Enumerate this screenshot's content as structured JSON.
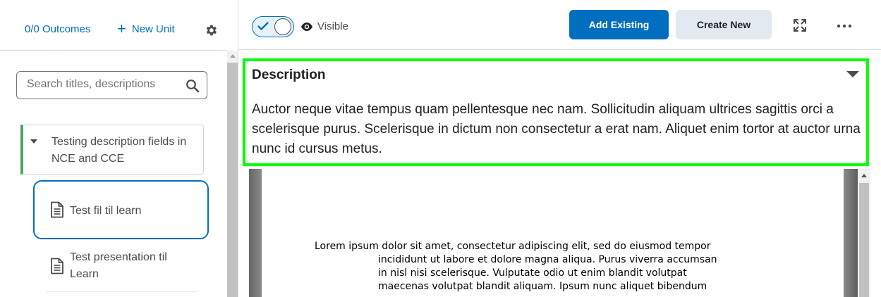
{
  "left_panel": {
    "outcomes_link": "0/0 Outcomes",
    "new_unit_label": "New Unit",
    "search": {
      "placeholder": "Search titles, descriptions",
      "value": ""
    },
    "unit": {
      "title": "Testing description fields in NCE and CCE",
      "expanded": true,
      "accent_color": "#46a661"
    },
    "lessons": [
      {
        "label": "Test fil til learn",
        "icon": "document-icon",
        "selected": true
      },
      {
        "label": "Test presentation til Learn",
        "icon": "document-icon",
        "selected": false
      }
    ]
  },
  "toolbar": {
    "visibility_toggle_on": true,
    "visibility_label": "Visible",
    "add_existing_label": "Add Existing",
    "create_new_label": "Create New",
    "icons": [
      "fullscreen-icon",
      "more-options-icon",
      "settings-gear-icon",
      "eye-icon"
    ]
  },
  "description": {
    "title": "Description",
    "body": "Auctor neque vitae tempus quam pellentesque nec nam. Sollicitudin aliquam ultrices sagittis orci a scelerisque purus. Scelerisque in dictum non consectetur a erat nam. Aliquet enim tortor at auctor urna nunc id cursus metus.",
    "highlight_color": "#00ff00"
  },
  "document_preview": {
    "first_line": "Lorem ipsum dolor sit amet, consectetur adipiscing elit, sed do eiusmod tempor",
    "continuation_lines": [
      "incididunt ut labore et dolore magna aliqua. Purus viverra accumsan",
      "in nisl nisi scelerisque. Vulputate odio ut enim blandit volutpat",
      "maecenas volutpat blandit aliquam. Ipsum nunc aliquet bibendum"
    ]
  },
  "colors": {
    "primary": "#006fbf",
    "secondary_button": "#e3e9f1",
    "text": "#202122",
    "muted_text": "#494c4e"
  }
}
